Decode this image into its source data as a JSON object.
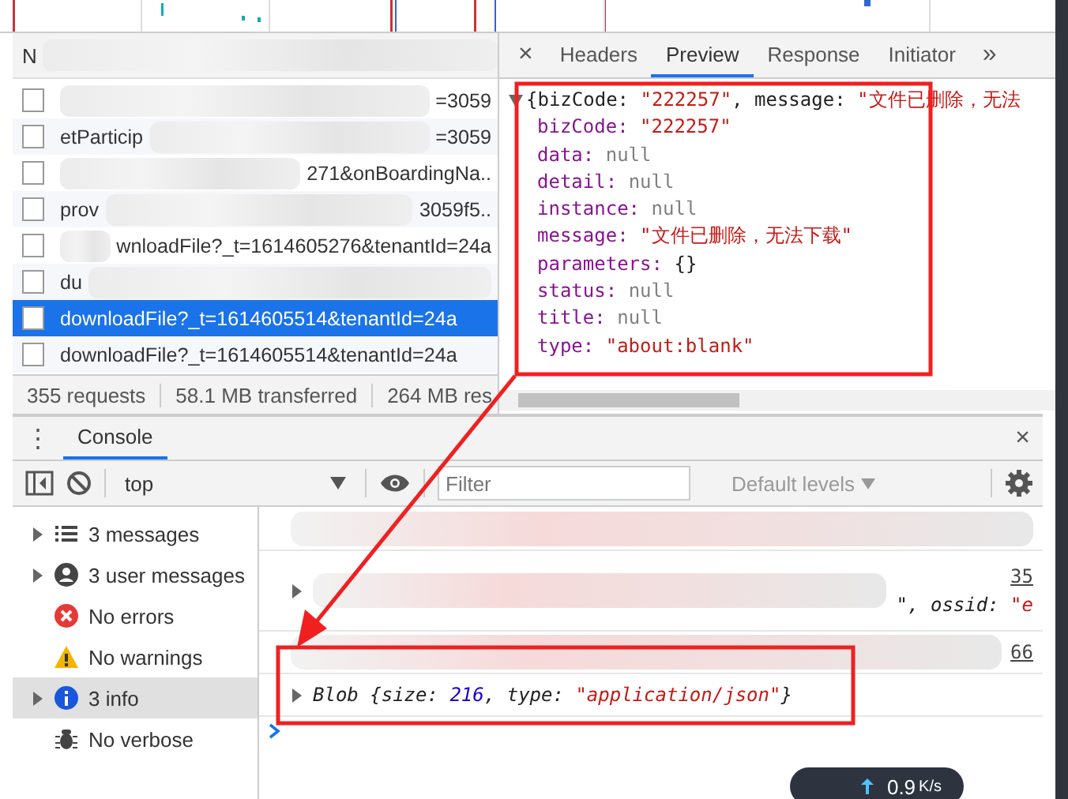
{
  "network": {
    "header": "N",
    "rows": [
      {
        "selected": false,
        "parts": [
          {
            "kind": "blur"
          },
          {
            "kind": "text",
            "text": "=3059"
          }
        ]
      },
      {
        "selected": false,
        "parts": [
          {
            "kind": "text",
            "text": "etParticip"
          },
          {
            "kind": "blur"
          },
          {
            "kind": "text",
            "text": "=3059"
          }
        ]
      },
      {
        "selected": false,
        "parts": [
          {
            "kind": "blur"
          },
          {
            "kind": "text",
            "text": "271&onBoardingNa.."
          }
        ]
      },
      {
        "selected": false,
        "parts": [
          {
            "kind": "text",
            "text": "prov"
          },
          {
            "kind": "blur"
          },
          {
            "kind": "text",
            "text": "3059f5.."
          }
        ]
      },
      {
        "selected": false,
        "parts": [
          {
            "kind": "blur"
          },
          {
            "kind": "text",
            "text": "wnloadFile?_t=1614605276&tenantId=24a"
          }
        ]
      },
      {
        "selected": false,
        "parts": [
          {
            "kind": "text",
            "text": "du"
          },
          {
            "kind": "blur"
          }
        ]
      },
      {
        "selected": true,
        "parts": [
          {
            "kind": "text",
            "text": "downloadFile?_t=1614605514&tenantId=24a"
          }
        ]
      },
      {
        "selected": false,
        "parts": [
          {
            "kind": "text",
            "text": "downloadFile?_t=1614605514&tenantId=24a"
          }
        ]
      }
    ],
    "status": [
      "355 requests",
      "58.1 MB transferred",
      "264 MB res"
    ]
  },
  "preview": {
    "close": "×",
    "more": "»",
    "tabs": [
      {
        "label": "Headers",
        "selected": false
      },
      {
        "label": "Preview",
        "selected": true
      },
      {
        "label": "Response",
        "selected": false
      },
      {
        "label": "Initiator",
        "selected": false
      }
    ],
    "summary": [
      {
        "kind": "plain",
        "text": "{bizCode: "
      },
      {
        "kind": "string",
        "text": "\"222257\""
      },
      {
        "kind": "plain",
        "text": ", message: "
      },
      {
        "kind": "string",
        "text": "\"文件已删除，无法"
      }
    ],
    "fields": [
      {
        "key": "bizCode:",
        "value": "\"222257\"",
        "kind": "string"
      },
      {
        "key": "data:",
        "value": "null",
        "kind": "null"
      },
      {
        "key": "detail:",
        "value": "null",
        "kind": "null"
      },
      {
        "key": "instance:",
        "value": "null",
        "kind": "null"
      },
      {
        "key": "message:",
        "value": "\"文件已删除，无法下载\"",
        "kind": "string"
      },
      {
        "key": "parameters:",
        "value": "{}",
        "kind": "plain"
      },
      {
        "key": "status:",
        "value": "null",
        "kind": "null"
      },
      {
        "key": "title:",
        "value": "null",
        "kind": "null"
      },
      {
        "key": "type:",
        "value": "\"about:blank\"",
        "kind": "string"
      }
    ]
  },
  "console": {
    "more": "⋮",
    "tab": {
      "label": "Console",
      "selected": true
    },
    "close": "×",
    "context": "top",
    "filter": {
      "placeholder": "Filter"
    },
    "levels": "Default levels",
    "sidebar": [
      {
        "label": "3 messages",
        "kind": "list",
        "expandable": true,
        "selected": false
      },
      {
        "label": "3 user messages",
        "kind": "user",
        "expandable": true,
        "selected": false
      },
      {
        "label": "No errors",
        "kind": "error",
        "expandable": false,
        "selected": false
      },
      {
        "label": "No warnings",
        "kind": "warning",
        "expandable": false,
        "selected": false
      },
      {
        "label": "3 info",
        "kind": "info",
        "expandable": true,
        "selected": true
      },
      {
        "label": "No verbose",
        "kind": "bug",
        "expandable": false,
        "selected": false
      }
    ],
    "messages": [
      {
        "kind": "redacted"
      },
      {
        "kind": "object",
        "link": "35",
        "tokens": [
          {
            "kind": "plain",
            "text": "\", ossid: "
          },
          {
            "kind": "string",
            "text": "\"e"
          }
        ]
      },
      {
        "kind": "redacted",
        "link": "66"
      },
      {
        "kind": "blob",
        "tokens": [
          {
            "kind": "plain",
            "text": "Blob {size: "
          },
          {
            "kind": "number",
            "text": "216"
          },
          {
            "kind": "plain",
            "text": ", type: "
          },
          {
            "kind": "string",
            "text": "\"application/json\""
          },
          {
            "kind": "plain",
            "text": "}"
          }
        ]
      }
    ]
  },
  "speed": {
    "value": "0.9",
    "unit": "K/s"
  }
}
